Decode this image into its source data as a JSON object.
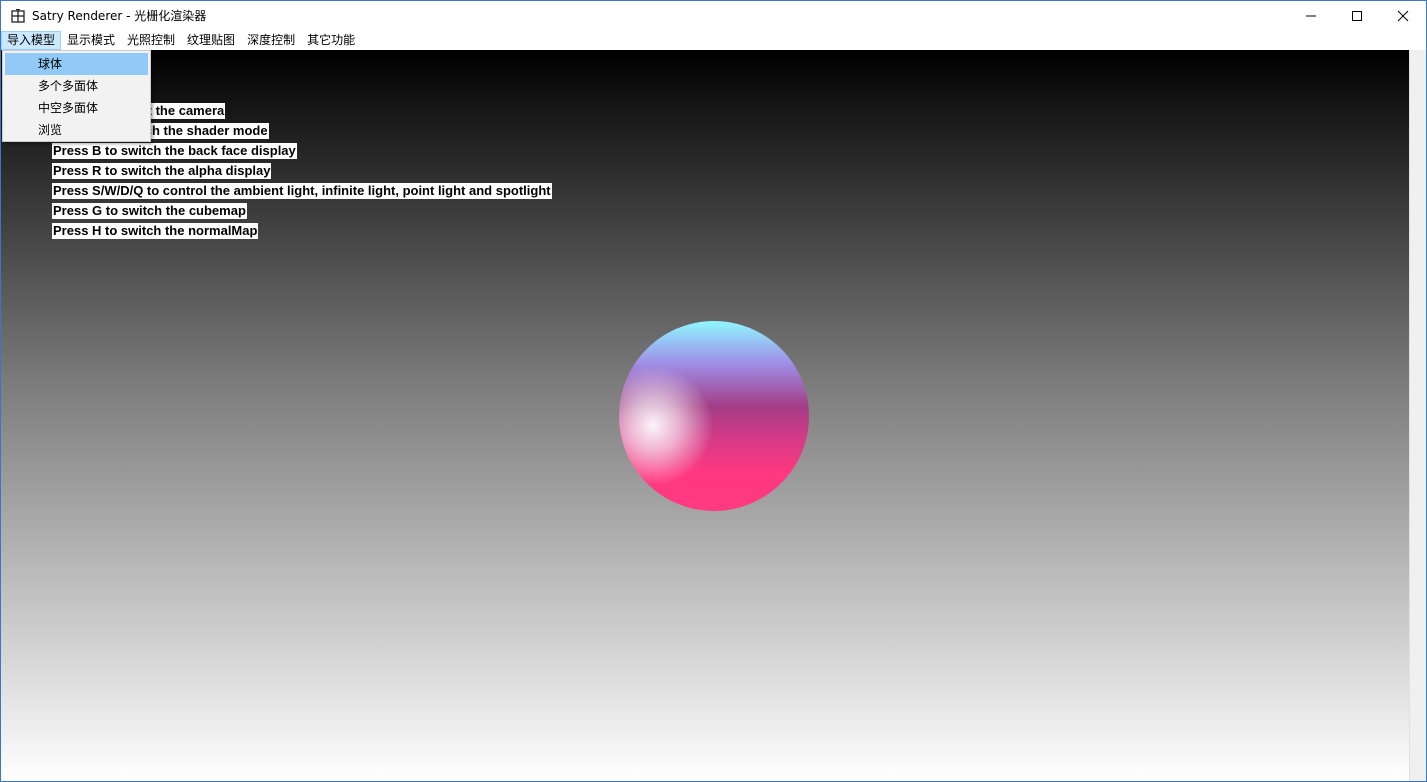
{
  "window": {
    "title": "Satry Renderer - 光栅化渲染器",
    "icon": "app-grid-icon",
    "controls": [
      "minimize-icon",
      "maximize-icon",
      "close-icon"
    ]
  },
  "menubar": {
    "items": [
      {
        "label": "导入模型",
        "active": true
      },
      {
        "label": "显示模式"
      },
      {
        "label": "光照控制"
      },
      {
        "label": "纹理贴图"
      },
      {
        "label": "深度控制"
      },
      {
        "label": "其它功能"
      }
    ]
  },
  "dropdown": {
    "items": [
      {
        "label": "球体",
        "highlighted": true
      },
      {
        "label": "多个多面体"
      },
      {
        "label": "中空多面体"
      },
      {
        "label": "浏览"
      }
    ]
  },
  "help": {
    "lines": [
      "Press C to reset the camera",
      "Press Z to switch the shader mode",
      "Press B to switch the back face display",
      "Press R to switch the alpha display",
      "Press S/W/D/Q to control the ambient light, infinite light, point light and spotlight",
      "Press G to switch the cubemap",
      "Press H to switch the normalMap"
    ]
  },
  "colors": {
    "window_border": "#3b78c4",
    "menu_active_bg": "#cce8ff",
    "dropdown_highlight": "#91c9f7",
    "sphere_top": "#8ff7ff",
    "sphere_bottom": "#ff3a80"
  }
}
